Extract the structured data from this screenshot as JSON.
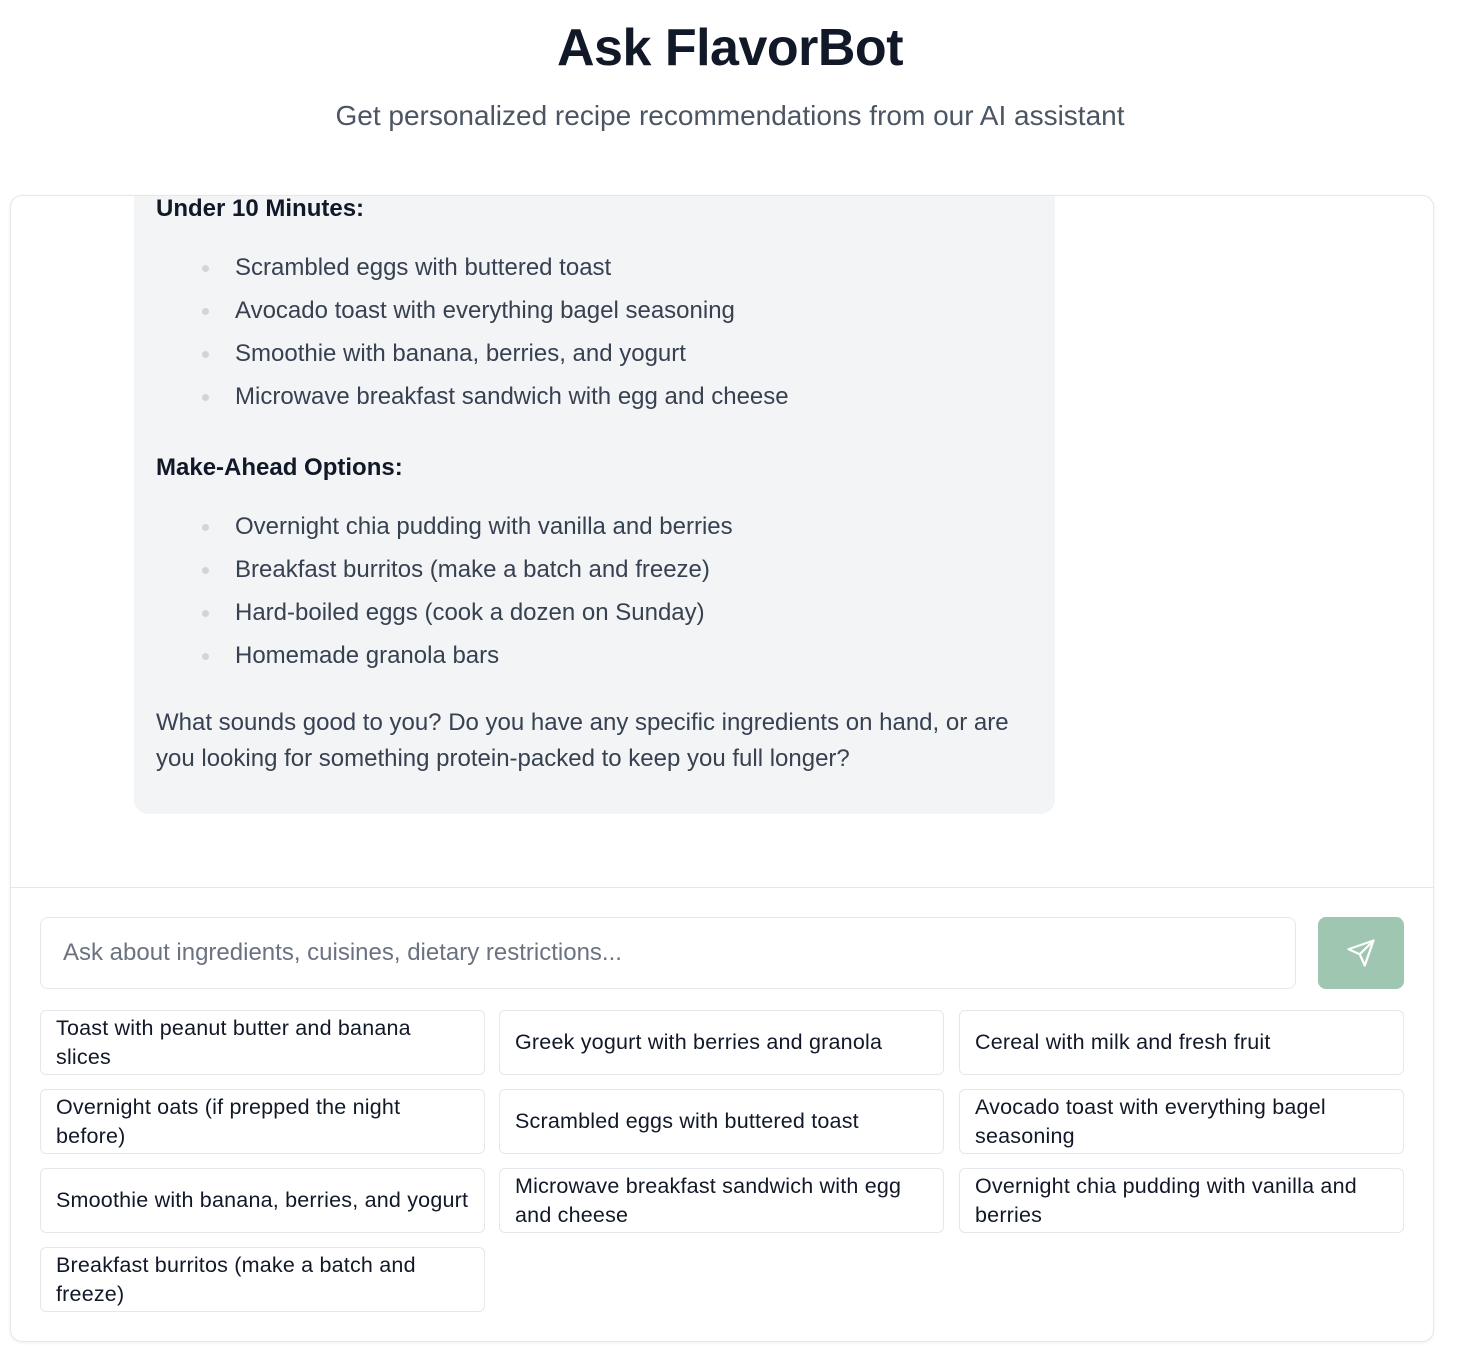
{
  "header": {
    "title": "Ask FlavorBot",
    "subtitle": "Get personalized recipe recommendations from our AI assistant"
  },
  "message": {
    "sections": [
      {
        "heading": "Under 10 Minutes:",
        "items": [
          "Scrambled eggs with buttered toast",
          "Avocado toast with everything bagel seasoning",
          "Smoothie with banana, berries, and yogurt",
          "Microwave breakfast sandwich with egg and cheese"
        ]
      },
      {
        "heading": "Make-Ahead Options:",
        "items": [
          "Overnight chia pudding with vanilla and berries",
          "Breakfast burritos (make a batch and freeze)",
          "Hard-boiled eggs (cook a dozen on Sunday)",
          "Homemade granola bars"
        ]
      }
    ],
    "closing": "What sounds good to you? Do you have any specific ingredients on hand, or are you looking for something protein-packed to keep you full longer?"
  },
  "composer": {
    "placeholder": "Ask about ingredients, cuisines, dietary restrictions...",
    "value": "",
    "send_icon": "send-icon",
    "send_color": "#9fc6b0"
  },
  "suggestions": [
    "Toast with peanut butter and banana slices",
    "Greek yogurt with berries and granola",
    "Cereal with milk and fresh fruit",
    "Overnight oats (if prepped the night before)",
    "Scrambled eggs with buttered toast",
    "Avocado toast with everything bagel seasoning",
    "Smoothie with banana, berries, and yogurt",
    "Microwave breakfast sandwich with egg and cheese",
    "Overnight chia pudding with vanilla and berries",
    "Breakfast burritos (make a batch and freeze)"
  ]
}
